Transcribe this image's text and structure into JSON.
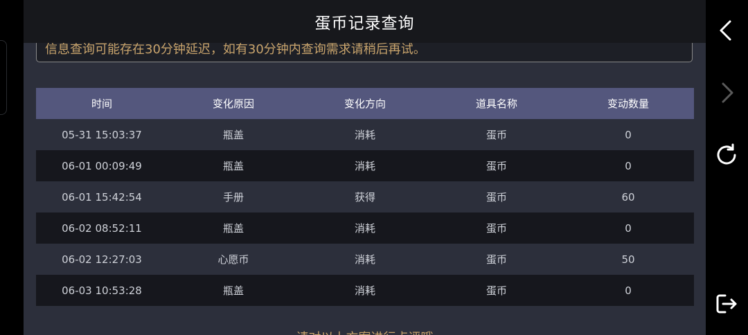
{
  "header": {
    "title": "蛋币记录查询"
  },
  "notice": {
    "text": "信息查询可能存在30分钟延迟，如有30分钟内查询需求请稍后再试。"
  },
  "table": {
    "columns": [
      "时间",
      "变化原因",
      "变化方向",
      "道具名称",
      "变动数量"
    ],
    "rows": [
      [
        "05-31 15:03:37",
        "瓶盖",
        "消耗",
        "蛋币",
        "0"
      ],
      [
        "06-01 00:09:49",
        "瓶盖",
        "消耗",
        "蛋币",
        "0"
      ],
      [
        "06-01 15:42:54",
        "手册",
        "获得",
        "蛋币",
        "60"
      ],
      [
        "06-02 08:52:11",
        "瓶盖",
        "消耗",
        "蛋币",
        "0"
      ],
      [
        "06-02 12:27:03",
        "心愿币",
        "消耗",
        "蛋币",
        "50"
      ],
      [
        "06-03 10:53:28",
        "瓶盖",
        "消耗",
        "蛋币",
        "0"
      ]
    ]
  },
  "footer": {
    "text": "请对以上方案进行点评哦"
  },
  "rail": {
    "icons": [
      "back-icon",
      "forward-icon",
      "refresh-icon",
      "exit-icon"
    ]
  },
  "colors": {
    "header_row": "#54577d",
    "accent_text": "#c9a46c",
    "panel": "#2c2f3b"
  }
}
